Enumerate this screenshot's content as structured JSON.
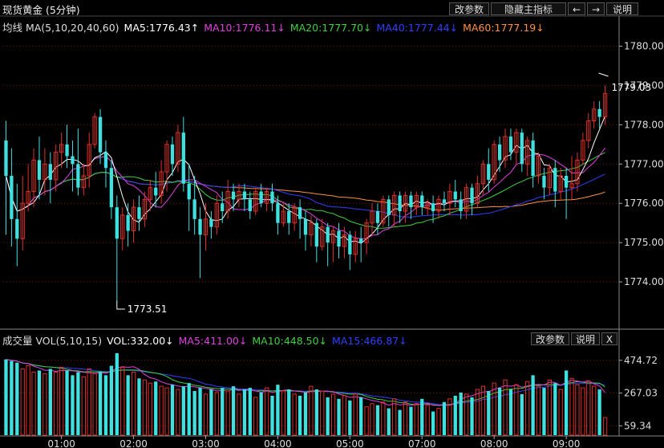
{
  "title": "现货黄金 (5分钟)",
  "toolbar": {
    "change_params": "改参数",
    "hide_indicator": "隐藏主指标",
    "left_arrow": "←",
    "right_arrow": "→",
    "help": "说明"
  },
  "main_header": {
    "name": "均线 MA(5,10,20,40,60)",
    "ma5": "MA5:1776.43↑",
    "ma10": "MA10:1776.11↓",
    "ma20": "MA20:1777.70↓",
    "ma40": "MA40:1777.44↓",
    "ma60": "MA60:1777.19↓"
  },
  "vol_header": {
    "name": "成交量 VOL(5,10,15)",
    "vol": "VOL:332.00↓",
    "ma5": "MA5:411.00↓",
    "ma10": "MA10:448.50↓",
    "ma15": "MA15:466.87↓"
  },
  "vol_toolbar": {
    "change_params": "改参数",
    "help": "说明",
    "close": "X"
  },
  "colors": {
    "up": "#e0302a",
    "down": "#3ee0e0",
    "ma5": "#ffffff",
    "ma10": "#e040e0",
    "ma20": "#40d040",
    "ma40": "#3040ff",
    "ma60": "#ff9040",
    "grid": "#7a1414"
  },
  "chart_data": [
    {
      "type": "candlestick",
      "title": "现货黄金 (5分钟)",
      "ylim": [
        1773.0,
        1780.4
      ],
      "yticks": [
        "1780.00",
        "1779.00",
        "1778.00",
        "1777.00",
        "1776.00",
        "1775.00",
        "1774.00"
      ],
      "xticks": [
        "01:00",
        "02:00",
        "03:00",
        "04:00",
        "05:00",
        "07:00",
        "08:00",
        "09:00"
      ],
      "xtick_index": [
        10,
        23,
        36,
        49,
        62,
        75,
        88,
        101
      ],
      "max_label": "1779.03",
      "min_label": "1773.51",
      "max_index": 108,
      "min_index": 20,
      "candles": [
        [
          1777.6,
          1776.7,
          1778.1,
          1775.2
        ],
        [
          1776.7,
          1775.6,
          1777.4,
          1774.9
        ],
        [
          1775.6,
          1775.1,
          1776.5,
          1774.4
        ],
        [
          1775.1,
          1776.0,
          1776.7,
          1774.8
        ],
        [
          1776.0,
          1776.3,
          1777.0,
          1775.8
        ],
        [
          1776.3,
          1777.1,
          1777.4,
          1775.9
        ],
        [
          1777.1,
          1776.6,
          1777.7,
          1776.1
        ],
        [
          1776.6,
          1777.0,
          1777.4,
          1776.2
        ],
        [
          1777.0,
          1776.6,
          1777.3,
          1776.0
        ],
        [
          1776.6,
          1777.3,
          1777.5,
          1776.3
        ],
        [
          1777.3,
          1777.5,
          1777.8,
          1776.9
        ],
        [
          1777.5,
          1777.2,
          1778.0,
          1776.9
        ],
        [
          1777.2,
          1777.0,
          1777.6,
          1776.3
        ],
        [
          1777.0,
          1776.4,
          1777.9,
          1776.2
        ],
        [
          1776.4,
          1776.7,
          1777.0,
          1776.2
        ],
        [
          1776.7,
          1777.5,
          1777.8,
          1776.4
        ],
        [
          1777.5,
          1778.2,
          1778.3,
          1777.4
        ],
        [
          1778.2,
          1777.3,
          1778.4,
          1777.0
        ],
        [
          1777.3,
          1776.9,
          1777.6,
          1776.4
        ],
        [
          1776.9,
          1775.9,
          1777.1,
          1775.6
        ],
        [
          1775.9,
          1775.1,
          1776.2,
          1773.5
        ],
        [
          1775.1,
          1775.7,
          1775.9,
          1774.8
        ],
        [
          1775.7,
          1775.3,
          1776.0,
          1774.9
        ],
        [
          1775.3,
          1775.9,
          1776.1,
          1775.0
        ],
        [
          1775.9,
          1775.6,
          1776.2,
          1775.3
        ],
        [
          1775.6,
          1776.1,
          1776.3,
          1775.4
        ],
        [
          1776.1,
          1776.4,
          1776.6,
          1775.8
        ],
        [
          1776.4,
          1776.2,
          1776.8,
          1775.9
        ],
        [
          1776.2,
          1776.8,
          1777.1,
          1776.0
        ],
        [
          1776.8,
          1777.5,
          1777.6,
          1776.3
        ],
        [
          1777.5,
          1777.0,
          1777.7,
          1776.7
        ],
        [
          1777.0,
          1777.8,
          1778.0,
          1776.8
        ],
        [
          1777.8,
          1776.5,
          1778.2,
          1776.3
        ],
        [
          1776.5,
          1776.1,
          1777.0,
          1775.3
        ],
        [
          1776.1,
          1775.6,
          1776.7,
          1775.2
        ],
        [
          1775.6,
          1775.2,
          1775.9,
          1774.1
        ],
        [
          1775.2,
          1775.6,
          1776.0,
          1774.8
        ],
        [
          1775.6,
          1775.4,
          1775.8,
          1775.1
        ],
        [
          1775.4,
          1776.0,
          1776.2,
          1775.2
        ],
        [
          1776.0,
          1775.8,
          1776.3,
          1775.5
        ],
        [
          1775.8,
          1776.3,
          1776.6,
          1775.6
        ],
        [
          1776.3,
          1776.1,
          1776.5,
          1775.8
        ],
        [
          1776.1,
          1776.3,
          1776.5,
          1775.9
        ],
        [
          1776.3,
          1776.1,
          1776.5,
          1775.8
        ],
        [
          1776.1,
          1775.8,
          1776.3,
          1775.6
        ],
        [
          1775.8,
          1776.3,
          1776.4,
          1775.7
        ],
        [
          1776.3,
          1776.0,
          1776.5,
          1775.9
        ],
        [
          1776.0,
          1776.3,
          1776.4,
          1775.8
        ],
        [
          1776.3,
          1776.0,
          1776.5,
          1775.8
        ],
        [
          1776.0,
          1775.5,
          1776.2,
          1775.2
        ],
        [
          1775.5,
          1775.8,
          1776.0,
          1775.4
        ],
        [
          1775.8,
          1775.5,
          1776.0,
          1775.2
        ],
        [
          1775.5,
          1775.9,
          1776.0,
          1775.3
        ],
        [
          1775.9,
          1775.6,
          1776.1,
          1775.1
        ],
        [
          1775.6,
          1775.2,
          1775.8,
          1774.8
        ],
        [
          1775.2,
          1775.5,
          1775.7,
          1774.9
        ],
        [
          1775.5,
          1774.9,
          1775.6,
          1774.5
        ],
        [
          1774.9,
          1775.4,
          1775.6,
          1774.8
        ],
        [
          1775.4,
          1775.0,
          1775.5,
          1774.4
        ],
        [
          1775.0,
          1775.3,
          1775.4,
          1774.5
        ],
        [
          1775.3,
          1774.9,
          1775.5,
          1774.6
        ],
        [
          1774.9,
          1775.2,
          1775.4,
          1774.6
        ],
        [
          1775.2,
          1774.7,
          1775.3,
          1774.3
        ],
        [
          1774.7,
          1775.1,
          1775.3,
          1774.5
        ],
        [
          1775.1,
          1775.0,
          1775.4,
          1774.5
        ],
        [
          1775.0,
          1775.5,
          1775.6,
          1774.7
        ],
        [
          1775.5,
          1775.8,
          1776.0,
          1775.2
        ],
        [
          1775.8,
          1775.5,
          1776.0,
          1775.2
        ],
        [
          1775.5,
          1776.1,
          1776.2,
          1775.4
        ],
        [
          1776.1,
          1775.7,
          1776.2,
          1775.4
        ],
        [
          1775.7,
          1776.2,
          1776.3,
          1775.4
        ],
        [
          1776.2,
          1775.8,
          1776.3,
          1775.5
        ],
        [
          1775.8,
          1776.2,
          1776.3,
          1775.5
        ],
        [
          1776.2,
          1775.9,
          1776.3,
          1775.6
        ],
        [
          1775.9,
          1776.2,
          1776.3,
          1775.7
        ],
        [
          1776.2,
          1775.9,
          1776.3,
          1775.7
        ],
        [
          1775.9,
          1776.0,
          1776.1,
          1775.7
        ],
        [
          1776.0,
          1775.8,
          1776.2,
          1775.5
        ],
        [
          1775.8,
          1776.1,
          1776.2,
          1775.6
        ],
        [
          1776.1,
          1776.0,
          1776.3,
          1775.8
        ],
        [
          1776.0,
          1776.3,
          1776.5,
          1775.7
        ],
        [
          1776.3,
          1776.1,
          1776.6,
          1775.9
        ],
        [
          1776.1,
          1775.8,
          1776.3,
          1775.6
        ],
        [
          1775.8,
          1776.4,
          1776.5,
          1775.6
        ],
        [
          1776.4,
          1776.0,
          1776.5,
          1775.7
        ],
        [
          1776.0,
          1776.5,
          1776.7,
          1775.9
        ],
        [
          1776.5,
          1777.0,
          1777.1,
          1776.2
        ],
        [
          1777.0,
          1776.6,
          1777.4,
          1776.3
        ],
        [
          1776.6,
          1777.5,
          1777.6,
          1776.5
        ],
        [
          1777.5,
          1777.1,
          1777.7,
          1776.8
        ],
        [
          1777.1,
          1777.7,
          1777.9,
          1776.9
        ],
        [
          1777.7,
          1777.3,
          1777.9,
          1777.1
        ],
        [
          1777.3,
          1777.8,
          1777.9,
          1777.0
        ],
        [
          1777.8,
          1777.0,
          1777.9,
          1776.8
        ],
        [
          1777.0,
          1777.6,
          1777.7,
          1776.7
        ],
        [
          1777.6,
          1776.7,
          1777.8,
          1776.4
        ],
        [
          1776.7,
          1777.2,
          1777.3,
          1776.5
        ],
        [
          1776.7,
          1776.4,
          1776.9,
          1776.1
        ],
        [
          1776.4,
          1776.9,
          1777.0,
          1776.2
        ],
        [
          1776.9,
          1776.3,
          1777.1,
          1775.9
        ],
        [
          1776.3,
          1776.7,
          1776.9,
          1776.1
        ],
        [
          1776.7,
          1776.4,
          1776.9,
          1775.6
        ],
        [
          1776.4,
          1776.5,
          1777.2,
          1776.1
        ],
        [
          1776.5,
          1777.1,
          1777.3,
          1776.3
        ],
        [
          1777.1,
          1777.6,
          1777.8,
          1777.0
        ],
        [
          1777.6,
          1778.1,
          1778.3,
          1777.4
        ],
        [
          1778.1,
          1778.4,
          1778.6,
          1777.9
        ],
        [
          1778.4,
          1778.2,
          1778.6,
          1777.9
        ],
        [
          1778.2,
          1778.8,
          1779.0,
          1778.0
        ]
      ]
    },
    {
      "type": "bar",
      "title": "成交量 VOL(5,10,15)",
      "ylim": [
        0,
        560
      ],
      "yticks": [
        "474.72",
        "267.03",
        "59.34"
      ],
      "volumes": [
        480,
        470,
        460,
        420,
        440,
        400,
        410,
        390,
        420,
        400,
        430,
        410,
        380,
        400,
        370,
        420,
        390,
        400,
        380,
        440,
        520,
        430,
        380,
        400,
        360,
        350,
        330,
        340,
        310,
        300,
        320,
        290,
        310,
        330,
        280,
        300,
        260,
        290,
        270,
        300,
        280,
        310,
        260,
        290,
        300,
        240,
        270,
        300,
        250,
        320,
        280,
        290,
        260,
        250,
        270,
        310,
        290,
        280,
        240,
        260,
        230,
        250,
        220,
        260,
        240,
        180,
        200,
        190,
        210,
        170,
        230,
        160,
        210,
        180,
        200,
        230,
        190,
        150,
        170,
        210,
        230,
        250,
        270,
        260,
        240,
        290,
        310,
        280,
        330,
        300,
        350,
        290,
        320,
        260,
        340,
        380,
        310,
        300,
        350,
        330,
        290,
        410,
        360,
        320,
        300,
        340,
        310,
        290,
        112
      ]
    }
  ]
}
